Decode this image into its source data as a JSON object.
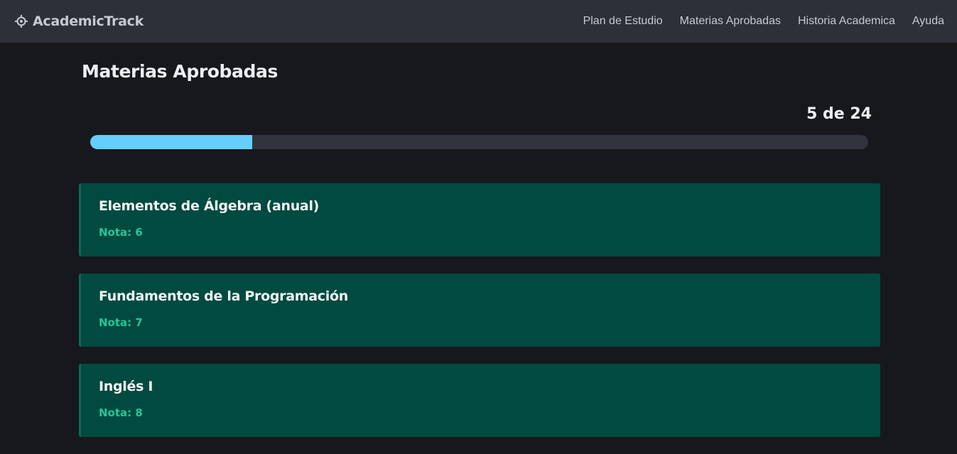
{
  "app": {
    "brand": "AcademicTrack",
    "brand_icon": "crosshair-icon"
  },
  "nav": {
    "items": [
      {
        "label": "Plan de Estudio"
      },
      {
        "label": "Materias Aprobadas"
      },
      {
        "label": "Historia Academica"
      },
      {
        "label": "Ayuda"
      }
    ]
  },
  "page": {
    "title": "Materias Aprobadas"
  },
  "progress": {
    "label": "5 de 24",
    "approved": 5,
    "total": 24,
    "fraction": 0.2083
  },
  "subjects": [
    {
      "name": "Elementos de Álgebra (anual)",
      "grade": "Nota: 6"
    },
    {
      "name": "Fundamentos de la Programación",
      "grade": "Nota: 7"
    },
    {
      "name": "Inglés I",
      "grade": "Nota: 8"
    }
  ],
  "colors": {
    "background": "#17181c",
    "navbar": "#2d3039",
    "accent": "#64cffc",
    "card": "#004a3f",
    "grade_text": "#22c79b"
  }
}
